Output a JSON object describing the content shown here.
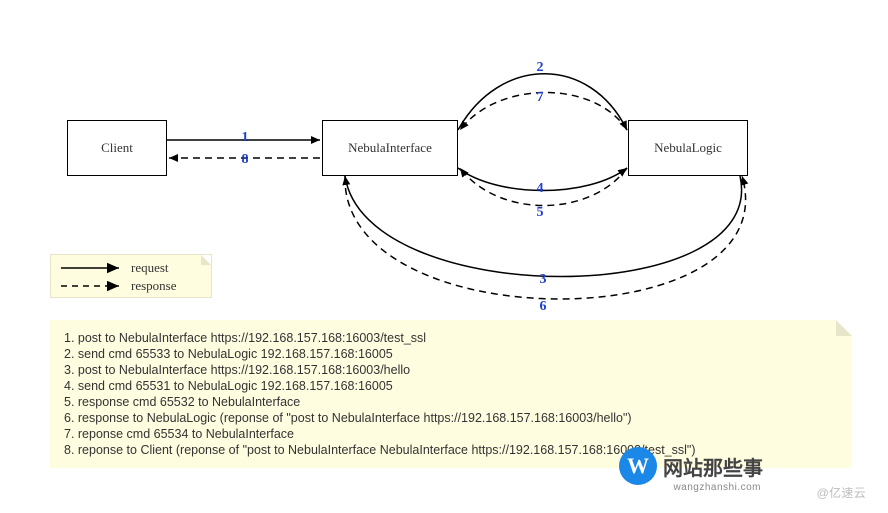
{
  "diagram": {
    "nodes": {
      "client": "Client",
      "interface": "NebulaInterface",
      "logic": "NebulaLogic"
    },
    "edges": [
      {
        "id": 1,
        "from": "client",
        "to": "interface",
        "type": "request"
      },
      {
        "id": 2,
        "from": "interface",
        "to": "logic",
        "type": "request"
      },
      {
        "id": 3,
        "from": "logic",
        "to": "interface",
        "type": "request"
      },
      {
        "id": 4,
        "from": "interface",
        "to": "logic",
        "type": "request"
      },
      {
        "id": 5,
        "from": "logic",
        "to": "interface",
        "type": "response"
      },
      {
        "id": 6,
        "from": "interface",
        "to": "logic",
        "type": "response"
      },
      {
        "id": 7,
        "from": "logic",
        "to": "interface",
        "type": "response"
      },
      {
        "id": 8,
        "from": "interface",
        "to": "client",
        "type": "response"
      }
    ]
  },
  "legend": {
    "request": "request",
    "response": "response"
  },
  "steps": [
    "1. post to NebulaInterface https://192.168.157.168:16003/test_ssl",
    "2. send cmd 65533 to  NebulaLogic 192.168.157.168:16005",
    "3. post to NebulaInterface https://192.168.157.168:16003/hello",
    "4. send cmd 65531 to  NebulaLogic 192.168.157.168:16005",
    "5. response cmd 65532 to NebulaInterface",
    "6. response to NebulaLogic (reponse of \"post to NebulaInterface https://192.168.157.168:16003/hello\")",
    "7. reponse cmd 65534 to NebulaInterface",
    "8. reponse to Client (reponse of \"post to NebulaInterface NebulaInterface https://192.168.157.168:16003/test_ssl\")"
  ],
  "watermarks": {
    "yiyun": "@亿速云",
    "brand_badge": "W",
    "brand_text": "网站那些事",
    "brand_url": "wangzhanshi.com"
  }
}
